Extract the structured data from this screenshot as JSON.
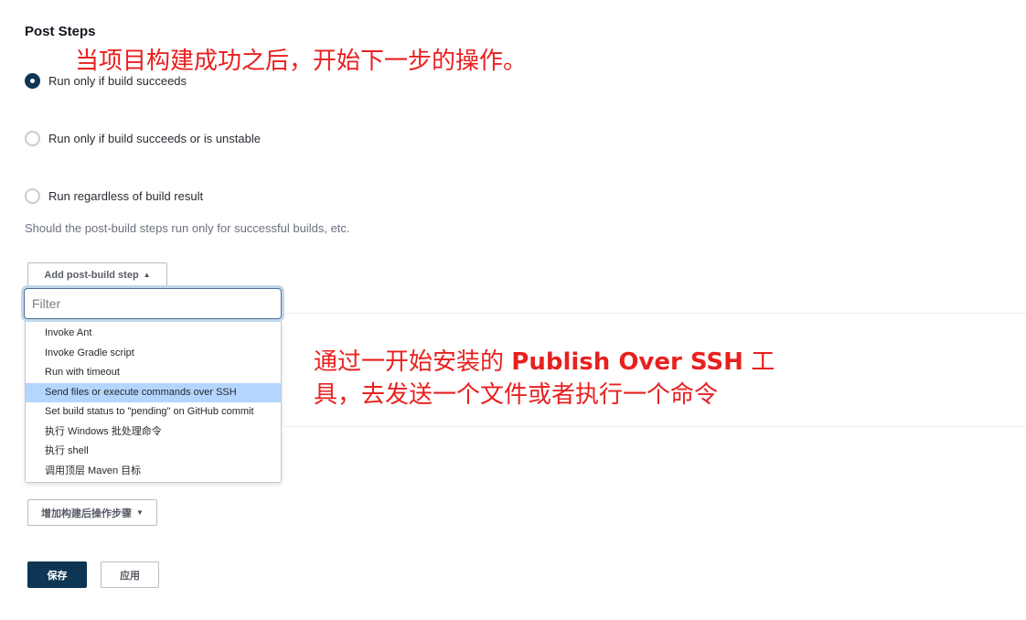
{
  "section": {
    "title": "Post Steps"
  },
  "annotations": {
    "top": "当项目构建成功之后，开始下一步的操作。",
    "middle_line1_prefix": "通过一开始安装的",
    "middle_line1_bold": "Publish Over SSH",
    "middle_line1_suffix": "工",
    "middle_line2": "具，去发送一个文件或者执行一个命令",
    "color": "#e8201f"
  },
  "radios": [
    {
      "label": "Run only if build succeeds",
      "checked": true
    },
    {
      "label": "Run only if build succeeds or is unstable",
      "checked": false
    },
    {
      "label": "Run regardless of build result",
      "checked": false
    }
  ],
  "help_text": "Should the post-build steps run only for successful builds, etc.",
  "add_step_button": {
    "label": "Add post-build step",
    "icon": "caret-up-icon"
  },
  "filter": {
    "placeholder": "Filter",
    "value": ""
  },
  "menu_items": [
    {
      "label": "Invoke Ant",
      "highlighted": false
    },
    {
      "label": "Invoke Gradle script",
      "highlighted": false
    },
    {
      "label": "Run with timeout",
      "highlighted": false
    },
    {
      "label": "Send files or execute commands over SSH",
      "highlighted": true
    },
    {
      "label": "Set build status to \"pending\" on GitHub commit",
      "highlighted": false
    },
    {
      "label": "执行 Windows 批处理命令",
      "highlighted": false
    },
    {
      "label": "执行 shell",
      "highlighted": false
    },
    {
      "label": "调用顶层 Maven 目标",
      "highlighted": false
    }
  ],
  "add_post_build_action_button": {
    "label": "增加构建后操作步骤",
    "icon": "caret-down-icon"
  },
  "footer": {
    "save_label": "保存",
    "apply_label": "应用"
  },
  "colors": {
    "primary": "#0d3554",
    "highlight": "#b4d5fe"
  }
}
